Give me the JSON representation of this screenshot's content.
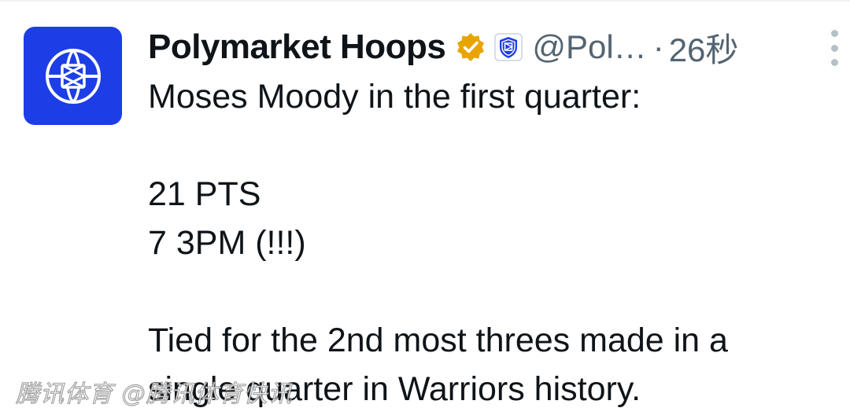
{
  "tweet": {
    "author": {
      "display_name": "Polymarket Hoops",
      "handle": "@Pol…",
      "avatar_icon": "polymarket-basketball-logo-icon",
      "avatar_color": "#1d3ee6",
      "verified_badge_icon": "gold-verified-badge-icon",
      "verified_badge_color": "#e8a400",
      "affiliate_badge_icon": "polymarket-affiliate-shield-icon",
      "affiliate_badge_color": "#1d3ee6"
    },
    "separator": "·",
    "timestamp": "26秒",
    "more_menu_icon": "more-options-vertical-icon",
    "lines": [
      "Moses Moody in the first quarter:",
      "",
      "21 PTS",
      "7 3PM (!!!)",
      "",
      "Tied for the 2nd most threes made in a",
      "single quarter in Warriors history."
    ]
  },
  "watermark": {
    "text": "腾讯体育 @腾讯体育快讯"
  }
}
